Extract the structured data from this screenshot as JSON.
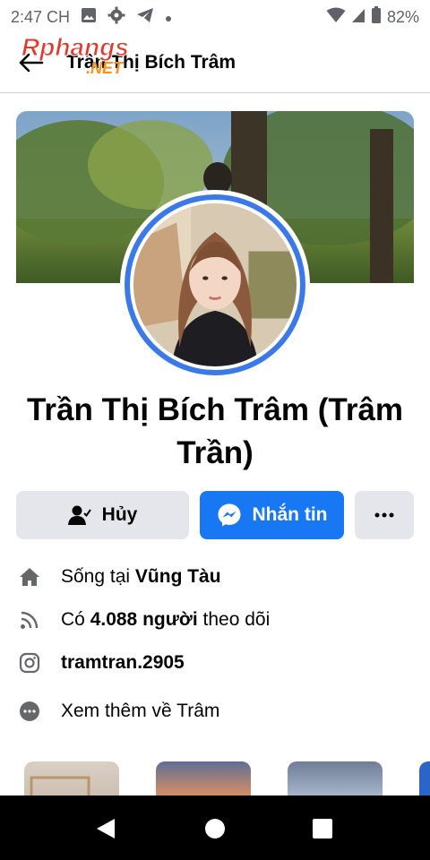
{
  "status_bar": {
    "time": "2:47 CH",
    "battery": "82%",
    "icons": [
      "image-icon",
      "gear-icon",
      "telegram-icon",
      "dot-icon",
      "wifi-icon",
      "signal-icon",
      "battery-icon"
    ]
  },
  "app_bar": {
    "title": "Trần Thị Bích Trâm",
    "back_icon": "back-arrow-icon",
    "watermark_main": "Rphangs",
    "watermark_sub": ".NET"
  },
  "profile": {
    "name": "Trần Thị Bích Trâm (Trâm Trần)"
  },
  "actions": {
    "cancel_label": "Hủy",
    "message_label": "Nhắn tin",
    "more_label": "···",
    "accent": "#1877f2"
  },
  "info": {
    "lives_prefix": "Sống tại ",
    "lives_city": "Vũng Tàu",
    "follow_prefix": "Có ",
    "follow_count": "4.088 người",
    "follow_suffix": " theo dõi",
    "instagram": "tramtran.2905",
    "see_more": "Xem thêm về Trâm"
  },
  "colors": {
    "ring": "#3b79e8",
    "button_gray": "#e4e6eb"
  }
}
